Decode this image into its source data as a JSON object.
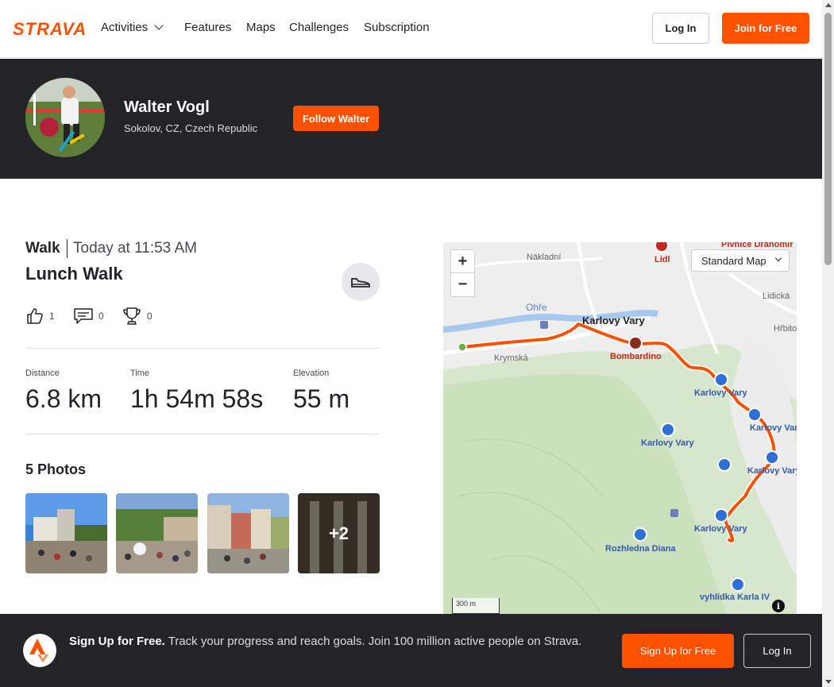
{
  "brand": {
    "logo_text": "STRAVA",
    "accent": "#fc5200",
    "dark": "#242428"
  },
  "nav": {
    "items": [
      {
        "label": "Activities",
        "has_dropdown": true
      },
      {
        "label": "Features"
      },
      {
        "label": "Maps"
      },
      {
        "label": "Challenges"
      },
      {
        "label": "Subscription"
      }
    ],
    "login_label": "Log In",
    "join_label": "Join for Free"
  },
  "athlete": {
    "name": "Walter Vogl",
    "location": "Sokolov, CZ, Czech Republic",
    "follow_label": "Follow Walter"
  },
  "activity": {
    "type": "Walk",
    "time": "Today at 11:53 AM",
    "title": "Lunch Walk",
    "kudos": "1",
    "comments": "0",
    "achievements": "0",
    "stats": [
      {
        "label": "Distance",
        "value": "6.8 km"
      },
      {
        "label": "Time",
        "value": "1h 54m 58s"
      },
      {
        "label": "Elevation",
        "value": "55 m"
      }
    ]
  },
  "photos": {
    "title": "5 Photos",
    "more_label": "+2"
  },
  "map": {
    "zoom_in": "+",
    "zoom_out": "−",
    "style_select": "Standard Map",
    "scale_label": "300 m",
    "info_icon": "i",
    "labels": {
      "karlovy_vary_main": "Karlovy Vary",
      "bombardino": "Bombardino",
      "lidl": "Lidl",
      "nakladni": "Nákladní",
      "ohre": "Ohře",
      "krymska": "Krymská",
      "pivnice": "Pivnice Dranomir",
      "lidicka": "Lidická",
      "hrbitov": "Hřbitov",
      "kv1": "Karlovy Vary",
      "kv2": "Karlovy Vary",
      "kv3": "Karlovy Vary",
      "kv4": "Karlovy Vary",
      "kv5": "Karlovy Vary",
      "rozhledna": "Rozhledna Diana",
      "vyhlidka": "vyhlídka Karla IV"
    }
  },
  "signup_banner": {
    "bold_text": "Sign Up for Free.",
    "text": " Track your progress and reach goals. Join 100 million active people on Strava.",
    "signup_label": "Sign Up for Free",
    "login_label": "Log In"
  }
}
